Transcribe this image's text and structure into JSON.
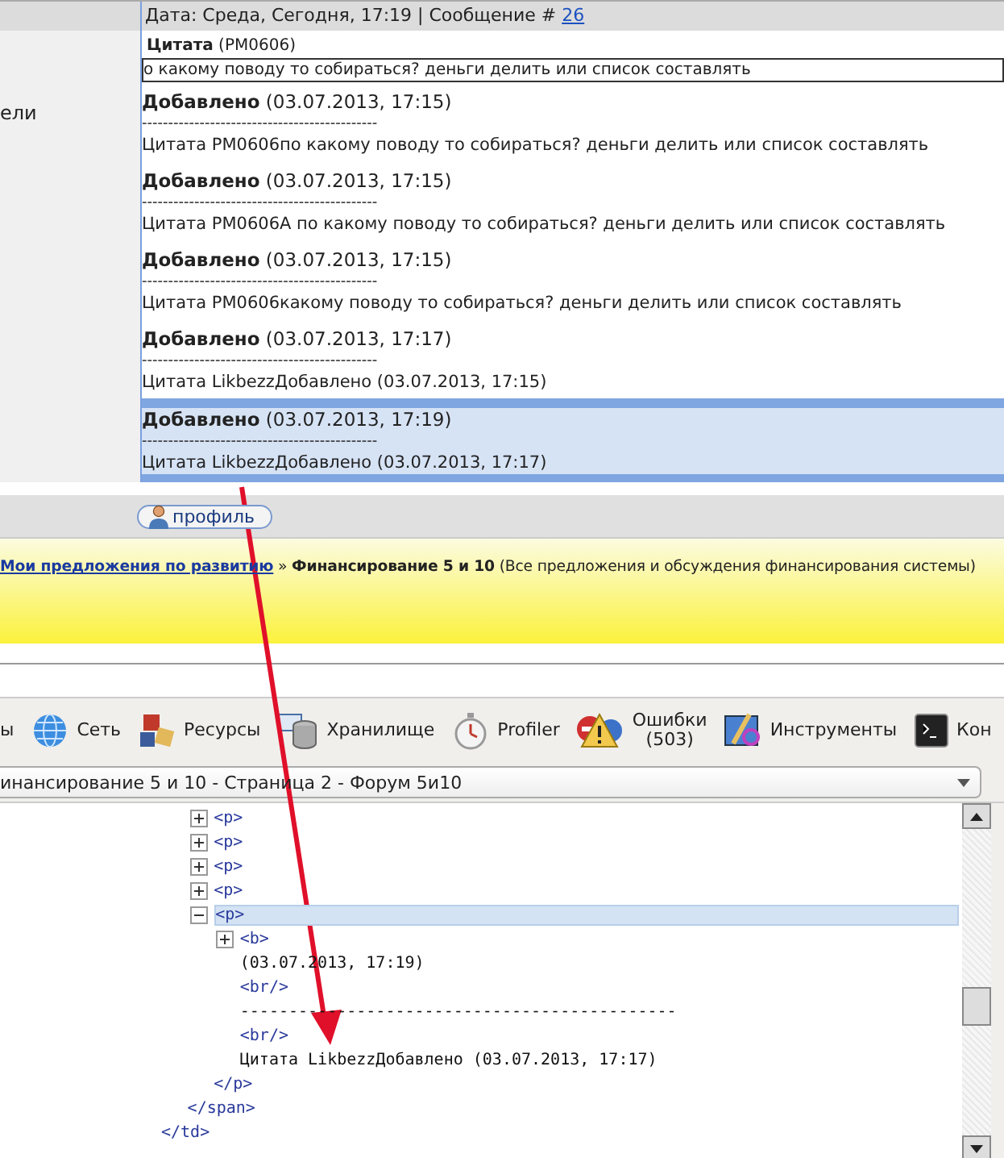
{
  "header": {
    "date": "Дата: Среда, Сегодня, 17:19 | Сообщение #",
    "message_number": "26"
  },
  "sidebar": {
    "text": "ели"
  },
  "quote": {
    "label": "Цитата",
    "author": "(PM0606)",
    "text": "о какому поводу то собираться? деньги делить или список составлять"
  },
  "posts": [
    {
      "label": "Добавлено",
      "date": "(03.07.2013, 17:15)",
      "separator": "---------------------------------------------",
      "text": "Цитата PM0606по какому поводу то собираться? деньги делить или список составлять",
      "highlighted": false
    },
    {
      "label": "Добавлено",
      "date": "(03.07.2013, 17:15)",
      "separator": "---------------------------------------------",
      "text": "Цитата PM0606A по какому поводу то собираться? деньги делить или список составлять",
      "highlighted": false
    },
    {
      "label": "Добавлено",
      "date": "(03.07.2013, 17:15)",
      "separator": "---------------------------------------------",
      "text": "Цитата PM0606какому поводу то собираться? деньги делить или список составлять",
      "highlighted": false
    },
    {
      "label": "Добавлено",
      "date": "(03.07.2013, 17:17)",
      "separator": "---------------------------------------------",
      "text": "Цитата LikbezzДобавлено (03.07.2013, 17:15)",
      "highlighted": false
    },
    {
      "label": "Добавлено",
      "date": "(03.07.2013, 17:19)",
      "separator": "---------------------------------------------",
      "text": "Цитата LikbezzДобавлено (03.07.2013, 17:17)",
      "highlighted": true
    }
  ],
  "profile_button": "профиль",
  "breadcrumb": {
    "link": "Мои предложения по развитию",
    "separator": "»",
    "title": "Финансирование 5 и 10",
    "description": "(Все предложения и обсуждения финансирования системы)"
  },
  "devtools": {
    "tabs": [
      {
        "label": "ы",
        "kind": "plain"
      },
      {
        "label": "Сеть",
        "kind": "network"
      },
      {
        "label": "Ресурсы",
        "kind": "resources"
      },
      {
        "label": "Хранилище",
        "kind": "storage"
      },
      {
        "label": "Profiler",
        "kind": "profiler"
      },
      {
        "label": "Ошибки",
        "count": "(503)",
        "kind": "errors"
      },
      {
        "label": "Инструменты",
        "kind": "tools"
      },
      {
        "label": "Кон",
        "kind": "console"
      }
    ],
    "page_select": "инансирование 5 и 10 - Страница 2 - Форум 5и10",
    "tree": [
      {
        "kind": "element",
        "close": "</td>",
        "children": [
          {
            "kind": "element",
            "close": "</span>",
            "children": [
              {
                "kind": "element",
                "label": "<p>",
                "expanded": false,
                "selected": false
              },
              {
                "kind": "element",
                "label": "<p>",
                "expanded": false,
                "selected": false
              },
              {
                "kind": "element",
                "label": "<p>",
                "expanded": false,
                "selected": false
              },
              {
                "kind": "element",
                "label": "<p>",
                "expanded": false,
                "selected": false
              },
              {
                "kind": "element",
                "label": "<p>",
                "expanded": true,
                "selected": true,
                "close": "</p>",
                "children": [
                  {
                    "kind": "element",
                    "label": "<b>",
                    "expanded": false
                  },
                  {
                    "kind": "text",
                    "label": "(03.07.2013, 17:19)"
                  },
                  {
                    "kind": "element",
                    "label": "<br/>"
                  },
                  {
                    "kind": "text",
                    "label": "---------------------------------------------"
                  },
                  {
                    "kind": "element",
                    "label": "<br/>"
                  },
                  {
                    "kind": "text",
                    "label": "Цитата LikbezzДобавлено (03.07.2013, 17:17)"
                  }
                ]
              }
            ]
          }
        ]
      }
    ]
  }
}
